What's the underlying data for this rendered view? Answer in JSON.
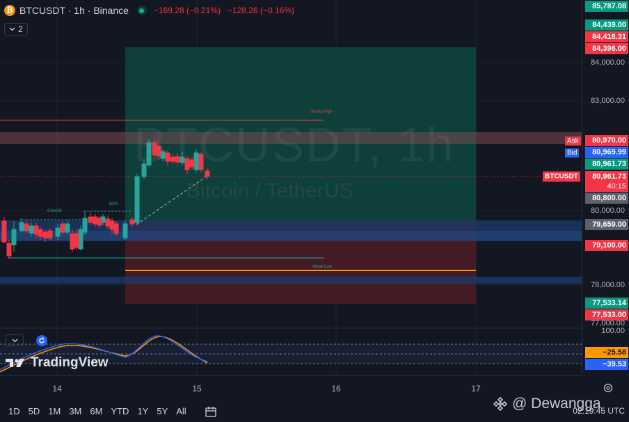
{
  "header": {
    "symbol_title": "BTCUSDT · 1h · Binance",
    "change_abs": "−169.28 (−0.21%)",
    "change_abs2": "−128.26 (−0.16%)",
    "coin_glyph": "₿"
  },
  "indicators_count": "2",
  "watermark": {
    "title": "BTCUSDT, 1h",
    "subtitle": "Bitcoin / TetherUS"
  },
  "chart_labels": {
    "strong_high": "Strong High",
    "weak_low": "Weak Low",
    "choch": "CHoCH",
    "bos": "BOS"
  },
  "price_axis": {
    "ticks": [
      "84,000.00",
      "83,000.00",
      "80,000.00",
      "78,000.00",
      "77,000.00",
      "100.00"
    ],
    "tags": {
      "top": "85,787.08",
      "t84439": "84,439.00",
      "t84418": "84,418.31",
      "t84396": "84,396.00",
      "t80970": "80,970.00",
      "ask_label": "Ask",
      "t80969": "80,969.99",
      "bid_label": "Bid",
      "t80961a": "80,961.73",
      "symbol_label": "BTCUSDT",
      "t80961b": "80,961.73",
      "countdown": "40:15",
      "t80800": "80,800.00",
      "t79659": "79,659.00",
      "t79100": "79,100.00",
      "t77533a": "77,533.14",
      "t77533b": "77,533.00",
      "osc1": "−25.58",
      "osc2": "−39.53"
    },
    "partial_tick": "80,000.00"
  },
  "time_axis": {
    "labels": [
      "14",
      "15",
      "16",
      "17"
    ]
  },
  "bottom_bar": {
    "ranges": [
      "1D",
      "5D",
      "1M",
      "3M",
      "6M",
      "YTD",
      "1Y",
      "5Y",
      "All"
    ],
    "time": "02:19:45 UTC"
  },
  "branding": {
    "tradingview": "TradingView",
    "credit": "@ Dewangga"
  },
  "colors": {
    "up": "#26a69a",
    "down": "#f23645",
    "accent": "#2962ff",
    "background": "#131722",
    "orange": "#ff9800"
  },
  "icons": [
    "bitcoin-coin-icon",
    "live-status-icon",
    "chevron-down-icon",
    "refresh-icon",
    "calendar-icon",
    "settings-icon",
    "binance-icon",
    "tradingview-logo-icon"
  ]
}
